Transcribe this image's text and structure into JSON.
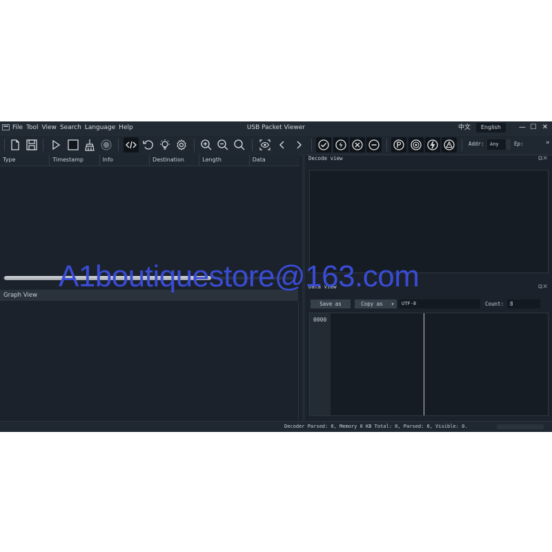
{
  "window": {
    "title": "USB Packet Viewer"
  },
  "menu": {
    "items": [
      "File",
      "Tool",
      "View",
      "Search",
      "Language",
      "Help"
    ]
  },
  "language": {
    "chinese": "中文",
    "english": "English"
  },
  "window_controls": {
    "minimize": "—",
    "maximize": "☐",
    "close": "✕"
  },
  "toolbar": {
    "addr_label": "Addr:",
    "addr_value": "Any",
    "ep_label": "Ep:",
    "overflow": "»"
  },
  "packet_table": {
    "columns": [
      "Type",
      "Timestamp",
      "Info",
      "Destination",
      "Length",
      "Data"
    ]
  },
  "graph_view": {
    "title": "Graph View"
  },
  "decode_view": {
    "title": "Decode view"
  },
  "data_view": {
    "title": "Data view",
    "save_label": "Save as",
    "copy_label": "Copy as",
    "encoding": "UTF-8",
    "count_label": "Count:",
    "count_value": "8",
    "offset": "0000"
  },
  "status": {
    "text": "Decoder Parsed: 0, Memory 0 KB  Total: 0, Parsed: 0, Visible: 0."
  },
  "watermark": {
    "text": "A1boutiquestore@163.com"
  },
  "colors": {
    "background": "#1b222b",
    "panel": "#161c23",
    "text": "#c9d1d9",
    "watermark": "#3a4cd6"
  }
}
